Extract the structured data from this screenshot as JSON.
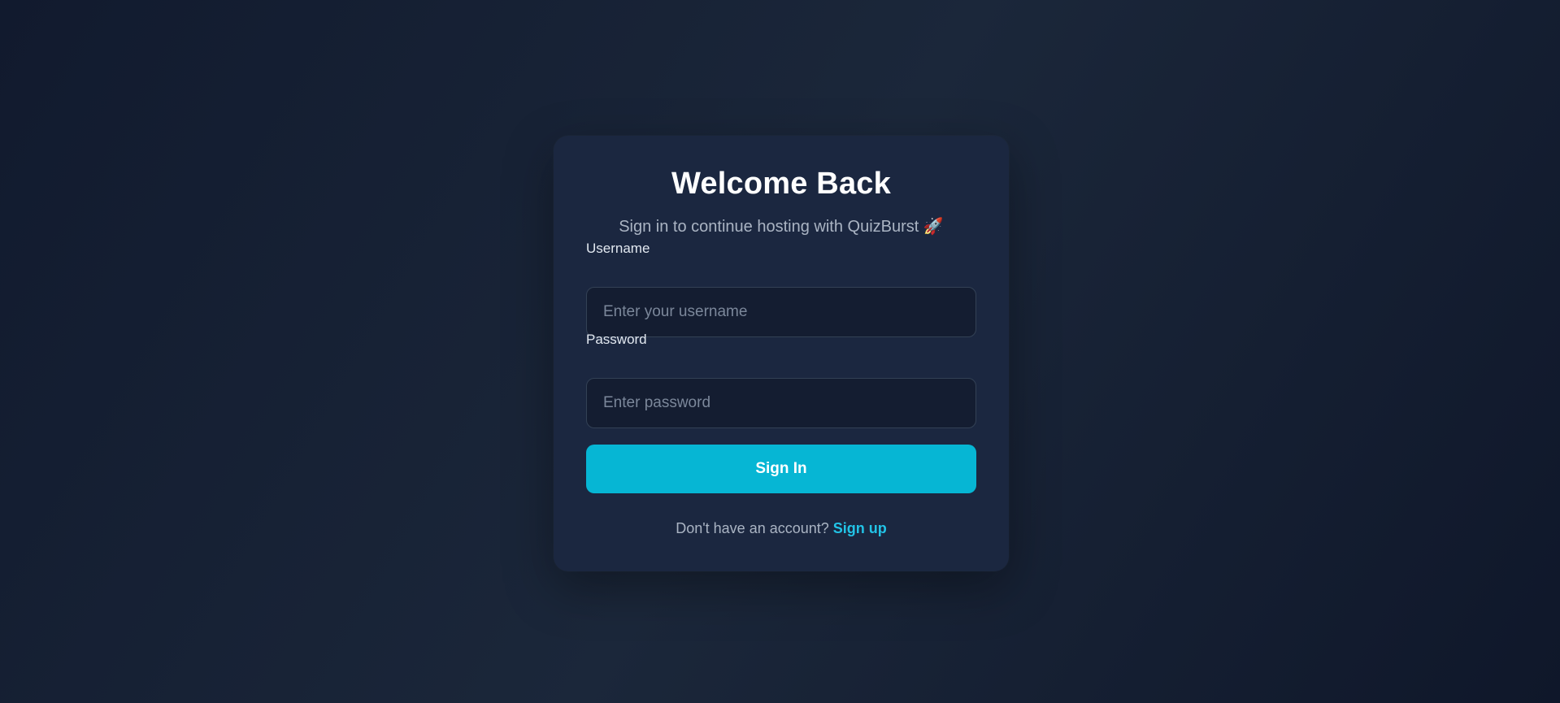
{
  "login": {
    "title": "Welcome Back",
    "subtitle": "Sign in to continue hosting with QuizBurst 🚀",
    "username_label": "Username",
    "username_placeholder": "Enter your username",
    "username_value": "",
    "password_label": "Password",
    "password_placeholder": "Enter password",
    "password_value": "",
    "signin_label": "Sign In",
    "footer_prompt": "Don't have an account?",
    "signup_label": "Sign up"
  },
  "colors": {
    "accent": "#06b6d4",
    "card_bg": "#1b2740",
    "input_bg": "#141d31",
    "link": "#22c3e6"
  }
}
